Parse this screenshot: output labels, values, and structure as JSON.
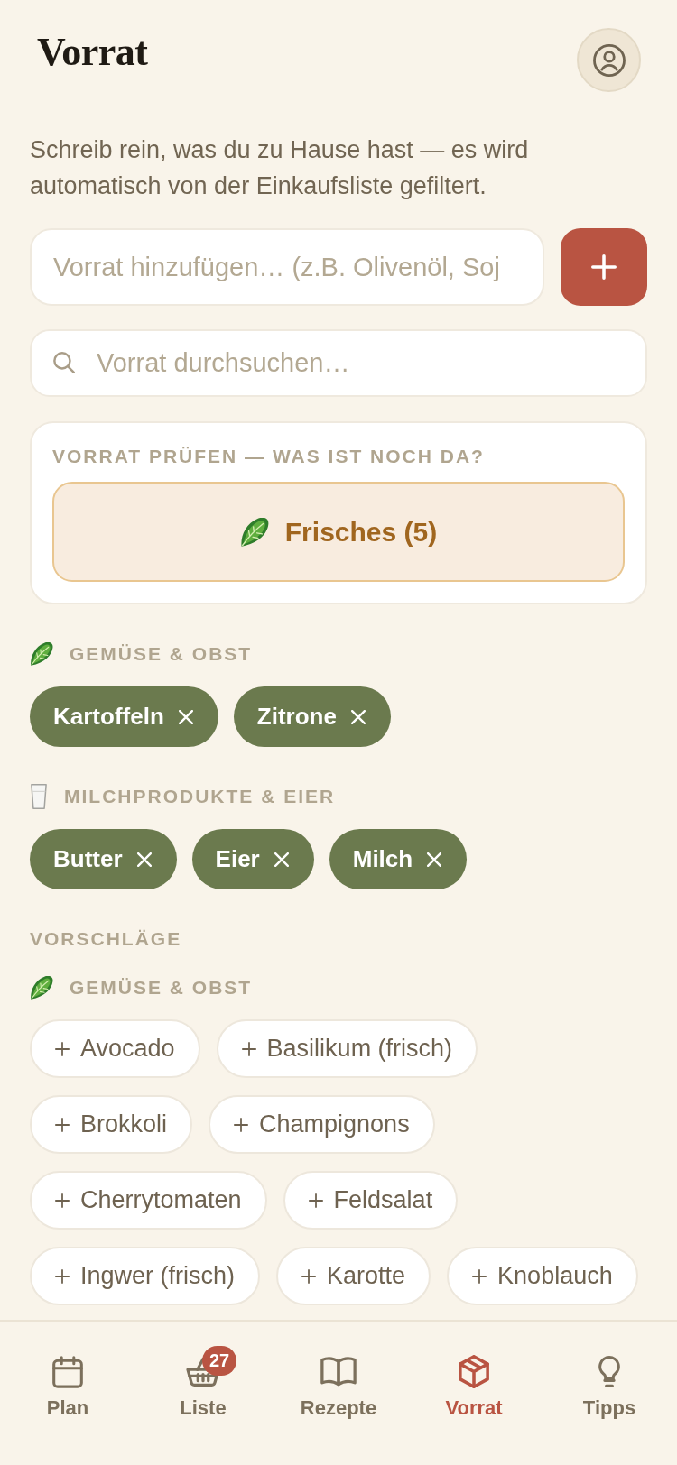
{
  "header": {
    "title": "Vorrat"
  },
  "intro": "Schreib rein, was du zu Hause hast — es wird automatisch von der Einkaufsliste gefiltert.",
  "add_field": {
    "placeholder": "Vorrat hinzufügen… (z.B. Olivenöl, Soj"
  },
  "search": {
    "placeholder": "Vorrat durchsuchen…"
  },
  "check_card": {
    "title": "VORRAT PRÜFEN — WAS IST NOCH DA?",
    "button": {
      "kind": "produce",
      "label": "Frisches (5)"
    }
  },
  "pantry": [
    {
      "kind": "produce",
      "category": "GEMÜSE & OBST",
      "items": [
        "Kartoffeln",
        "Zitrone"
      ]
    },
    {
      "kind": "dairy",
      "category": "MILCHPRODUKTE & EIER",
      "items": [
        "Butter",
        "Eier",
        "Milch"
      ]
    }
  ],
  "suggestions": {
    "title": "VORSCHLÄGE",
    "groups": [
      {
        "kind": "produce",
        "category": "GEMÜSE & OBST",
        "items": [
          "Avocado",
          "Basilikum (frisch)",
          "Brokkoli",
          "Champignons",
          "Cherrytomaten",
          "Feldsalat",
          "Ingwer (frisch)",
          "Karotte",
          "Knoblauch"
        ]
      }
    ]
  },
  "nav": [
    {
      "kind": "calendar",
      "label": "Plan",
      "selected": false
    },
    {
      "kind": "basket",
      "label": "Liste",
      "badge": "27",
      "selected": false
    },
    {
      "kind": "book",
      "label": "Rezepte",
      "selected": false
    },
    {
      "kind": "box",
      "label": "Vorrat",
      "selected": true
    },
    {
      "kind": "bulb",
      "label": "Tipps",
      "selected": false
    }
  ]
}
